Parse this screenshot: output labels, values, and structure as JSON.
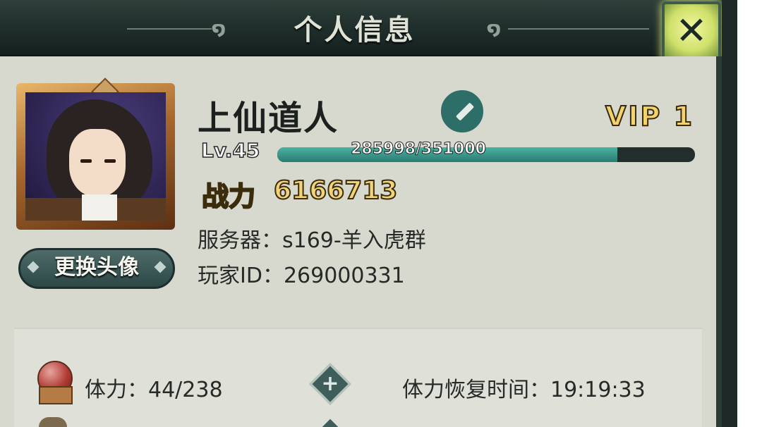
{
  "header": {
    "title": "个人信息",
    "close_icon": "close-icon"
  },
  "profile": {
    "name": "上仙道人",
    "vip": "VIP 1",
    "level": "Lv.45",
    "exp_text": "285998/351000",
    "exp_progress": 0.815,
    "power_label": "战力",
    "power_value": "6166713",
    "server": "服务器：s169-羊入虎群",
    "player_id": "玩家ID：269000331",
    "change_avatar_label": "更换头像"
  },
  "stats": {
    "stamina": "体力：44/238",
    "recover_time": "体力恢复时间：19:19:33"
  }
}
